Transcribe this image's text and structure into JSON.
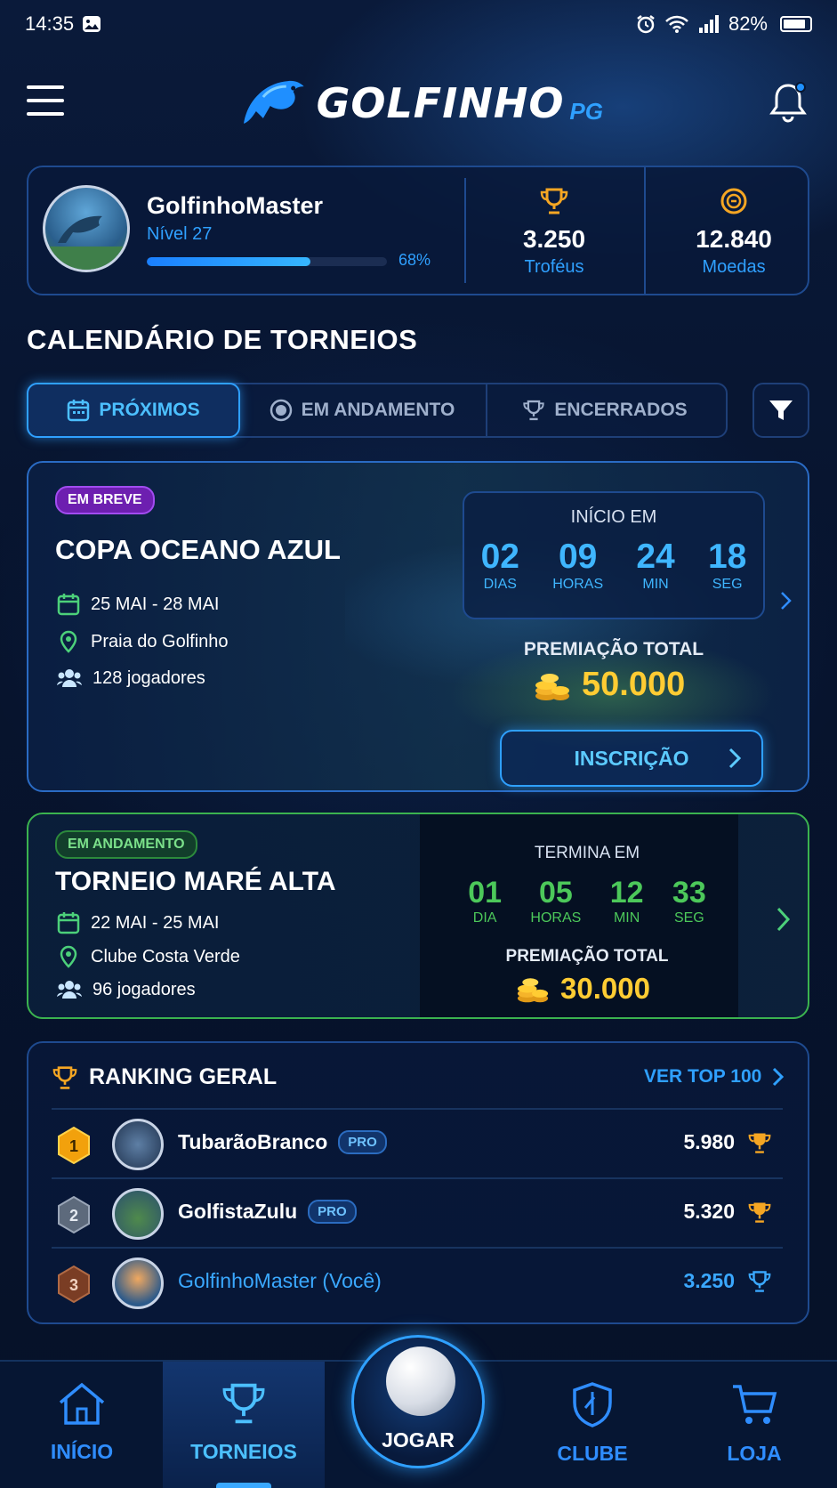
{
  "status": {
    "time": "14:35",
    "battery": "82%"
  },
  "header": {
    "brand": "GOLFINHO",
    "brand_suffix": "PG"
  },
  "profile": {
    "name": "GolfinhoMaster",
    "level": "Nível 27",
    "progress": 0.68,
    "progress_label": "68%",
    "trophies_value": "3.250",
    "trophies_label": "Troféus",
    "coins_value": "12.840",
    "coins_label": "Moedas"
  },
  "section_title": "CALENDÁRIO DE TORNEIOS",
  "tabs": [
    {
      "label": "PRÓXIMOS"
    },
    {
      "label": "EM ANDAMENTO"
    },
    {
      "label": "ENCERRADOS"
    }
  ],
  "tournaments": [
    {
      "badge": "EM BREVE",
      "title": "COPA OCEANO AZUL",
      "dates": "25 MAI - 28 MAI",
      "location": "Praia do Golfinho",
      "players": "128 jogadores",
      "countdown_title": "INÍCIO EM",
      "countdown": [
        {
          "n": "02",
          "u": "DIAS"
        },
        {
          "n": "09",
          "u": "HORAS"
        },
        {
          "n": "24",
          "u": "MIN"
        },
        {
          "n": "18",
          "u": "SEG"
        }
      ],
      "prize_label": "PREMIAÇÃO TOTAL",
      "prize_value": "50.000",
      "button": "INSCRIÇÃO"
    },
    {
      "badge": "EM ANDAMENTO",
      "title": "TORNEIO MARÉ ALTA",
      "dates": "22 MAI - 25 MAI",
      "location": "Clube Costa Verde",
      "players": "96 jogadores",
      "countdown_title": "TERMINA EM",
      "countdown": [
        {
          "n": "01",
          "u": "DIA"
        },
        {
          "n": "05",
          "u": "HORAS"
        },
        {
          "n": "12",
          "u": "MIN"
        },
        {
          "n": "33",
          "u": "SEG"
        }
      ],
      "prize_label": "PREMIAÇÃO TOTAL",
      "prize_value": "30.000"
    }
  ],
  "ranking": {
    "title": "RANKING GERAL",
    "link": "VER TOP 100",
    "rows": [
      {
        "pos": "1",
        "name": "TubarãoBranco",
        "pro": "PRO",
        "score": "5.980"
      },
      {
        "pos": "2",
        "name": "GolfistaZulu",
        "pro": "PRO",
        "score": "5.320"
      },
      {
        "pos": "3",
        "name": "GolfinhoMaster (Você)",
        "score": "3.250"
      }
    ]
  },
  "nav": {
    "home": "INÍCIO",
    "tournaments": "TORNEIOS",
    "play": "JOGAR",
    "club": "CLUBE",
    "shop": "LOJA"
  },
  "colors": {
    "accent": "#2fa0ff",
    "gold": "#ffcc33",
    "live": "#3bb34f",
    "soon": "#6d1fb0"
  }
}
